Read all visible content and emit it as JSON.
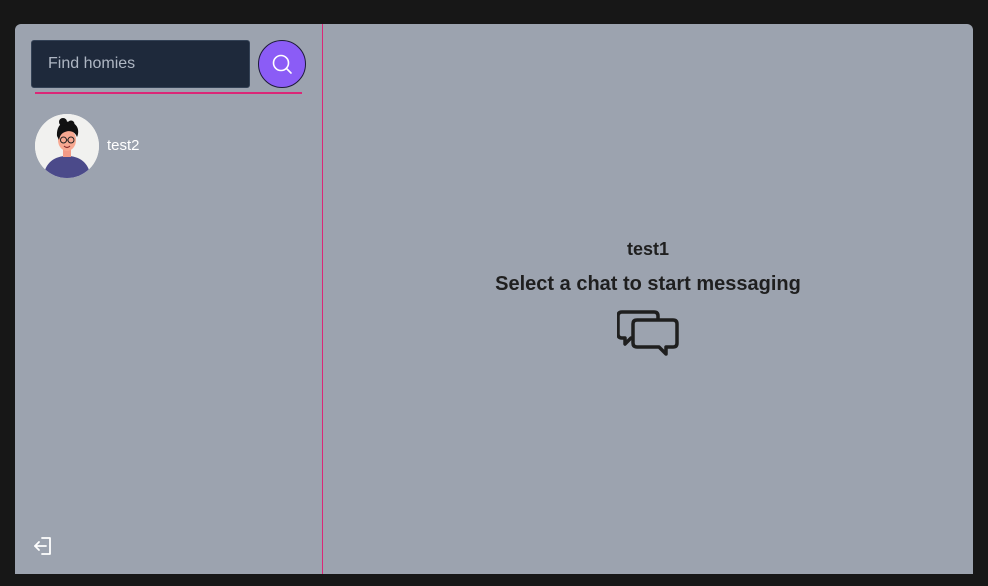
{
  "sidebar": {
    "search": {
      "placeholder": "Find homies",
      "value": ""
    },
    "search_button_icon": "search-icon",
    "conversations": [
      {
        "name": "test2",
        "avatar": "cartoon-person-avatar"
      }
    ],
    "logout_icon": "logout-icon"
  },
  "main": {
    "current_user": "test1",
    "message": "Select a chat to start messaging",
    "icon": "chat-bubbles-icon"
  },
  "colors": {
    "accent": "#8b5cf6",
    "divider": "#db2777",
    "panel_bg": "#9ca3af",
    "input_bg": "#1e293b",
    "page_bg": "#171717"
  }
}
